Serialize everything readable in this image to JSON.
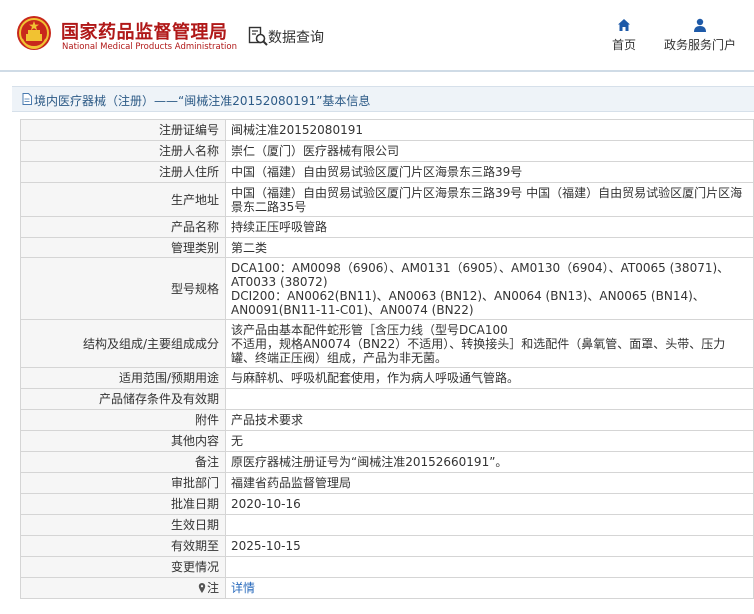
{
  "header": {
    "site_title": "国家药品监督管理局",
    "site_subtitle": "National Medical Products Administration",
    "search_label": "数据查询",
    "nav": {
      "home": "首页",
      "portal": "政务服务门户"
    }
  },
  "colors": {
    "brand": "#b01818",
    "link": "#2a6bbd",
    "crumb_text": "#2c5a86",
    "label_bg": "#f6f6f6"
  },
  "breadcrumb": "境内医疗器械（注册）——“闽械注准20152080191”基本信息",
  "rows": [
    {
      "label": "注册证编号",
      "value": "闽械注准20152080191"
    },
    {
      "label": "注册人名称",
      "value": "崇仁（厦门）医疗器械有限公司"
    },
    {
      "label": "注册人住所",
      "value": "中国（福建）自由贸易试验区厦门片区海景东三路39号"
    },
    {
      "label": "生产地址",
      "value": "中国（福建）自由贸易试验区厦门片区海景东三路39号 中国（福建）自由贸易试验区厦门片区海景东二路35号"
    },
    {
      "label": "产品名称",
      "value": "持续正压呼吸管路"
    },
    {
      "label": "管理类别",
      "value": "第二类"
    },
    {
      "label": "型号规格",
      "value": "DCA100：AM0098（6906）、AM0131（6905）、AM0130（6904）、AT0065 (38071)、AT0033 (38072)\nDCI200：AN0062(BN11)、AN0063 (BN12)、AN0064 (BN13)、AN0065 (BN14)、AN0091(BN11-11-C01)、AN0074 (BN22)"
    },
    {
      "label": "结构及组成/主要组成成分",
      "value": "该产品由基本配件蛇形管［含压力线（型号DCA100\n不适用，规格AN0074（BN22）不适用）、转换接头］和选配件（鼻氧管、面罩、头带、压力罐、终端正压阀）组成，产品为非无菌。"
    },
    {
      "label": "适用范围/预期用途",
      "value": "与麻醉机、呼吸机配套使用，作为病人呼吸通气管路。"
    },
    {
      "label": "产品储存条件及有效期",
      "value": ""
    },
    {
      "label": "附件",
      "value": "产品技术要求"
    },
    {
      "label": "其他内容",
      "value": "无"
    },
    {
      "label": "备注",
      "value": "原医疗器械注册证号为“闽械注准20152660191”。"
    },
    {
      "label": "审批部门",
      "value": "福建省药品监督管理局"
    },
    {
      "label": "批准日期",
      "value": "2020-10-16"
    },
    {
      "label": "生效日期",
      "value": ""
    },
    {
      "label": "有效期至",
      "value": "2025-10-15"
    },
    {
      "label": "变更情况",
      "value": ""
    }
  ],
  "note": {
    "label": "注",
    "value": "详情",
    "icon": "pin-icon"
  }
}
